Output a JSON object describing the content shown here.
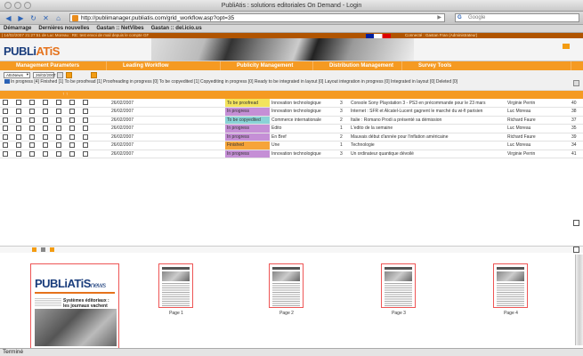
{
  "window": {
    "title": "PubliAtis : solutions editoriales On Demand - Login"
  },
  "toolbar": {
    "url": "http://publimanager.publiatis.com/grid_workflow.asp?opt=35",
    "search_placeholder": "Google"
  },
  "bookmarks": [
    "Démarrage",
    "Dernières nouvelles",
    "Gastan :: NetVibes",
    "Gastan :: del.icio.us"
  ],
  "infobar": {
    "left": "| 14/02/2007 21:27:51 de Luc Moreau : RE: test envoi de mail depuis le compte GF",
    "right": "Connecté : Gastan Fran (Administrateur)"
  },
  "logo": {
    "left": "PUBLi",
    "right": "ATiS"
  },
  "menu": [
    "Management Parameters",
    "Leading Workflow",
    "Publicity Management",
    "Distribution Management",
    "Survey Tools"
  ],
  "filter": {
    "select": "AttsNews",
    "date": "26/02/2007"
  },
  "status_counts": "In progress [4]  Finished [1]  To be proofread [1]  Proofreading in progress [0]  To be copyedited [1]  Copyediting in progress [0]  Ready to be integrated in layout [0]  Layout integration in progress [0]  Integrated in layout [0]  Deleted [0]",
  "colhead": "↑ ↑",
  "rows": [
    {
      "date": "26/02/2007",
      "status": "To be proofread",
      "status_class": "s-pr",
      "section": "Innovation technologique",
      "num": "3",
      "title": "Console Sony Playstation 3 - PS3 en précommande pour le 23 mars",
      "author": "Virginie Perrin",
      "id": "40"
    },
    {
      "date": "26/02/2007",
      "status": "In progress",
      "status_class": "s-ip",
      "section": "Innovation technologique",
      "num": "3",
      "title": "Internet : SFR et Alcatel-Lucent gagnent le marché du wi-fi parisien",
      "author": "Luc Moreau",
      "id": "38"
    },
    {
      "date": "26/02/2007",
      "status": "To be copyedited",
      "status_class": "s-tc",
      "section": "Commerce internationale",
      "num": "2",
      "title": "Italie : Romano Prodi a présenté sa démission",
      "author": "Richard Faure",
      "id": "37"
    },
    {
      "date": "26/02/2007",
      "status": "In progress",
      "status_class": "s-ip",
      "section": "Edito",
      "num": "1",
      "title": "L'edito de la semaine",
      "author": "Luc Moreau",
      "id": "35"
    },
    {
      "date": "26/02/2007",
      "status": "In progress",
      "status_class": "s-ip",
      "section": "En Bref",
      "num": "2",
      "title": "Mauvais début d'année pour l'inflation américaine",
      "author": "Richard Faure",
      "id": "39"
    },
    {
      "date": "26/02/2007",
      "status": "Finished",
      "status_class": "s-fi",
      "section": "Une",
      "num": "1",
      "title": "Technologie",
      "author": "Luc Moreau",
      "id": "34"
    },
    {
      "date": "26/02/2007",
      "status": "In progress",
      "status_class": "s-ip",
      "section": "Innovation technologique",
      "num": "3",
      "title": "Un ordinateur quantique dévoilé",
      "author": "Virginie Perrin",
      "id": "41"
    }
  ],
  "cover": {
    "brand": "PUBLiATiS",
    "suffix": "news",
    "headline": "Systèmes éditoriaux : les journaux vachent innovés"
  },
  "pages": [
    "Page 1",
    "Page 2",
    "Page 3",
    "Page 4"
  ],
  "status": "Terminé"
}
